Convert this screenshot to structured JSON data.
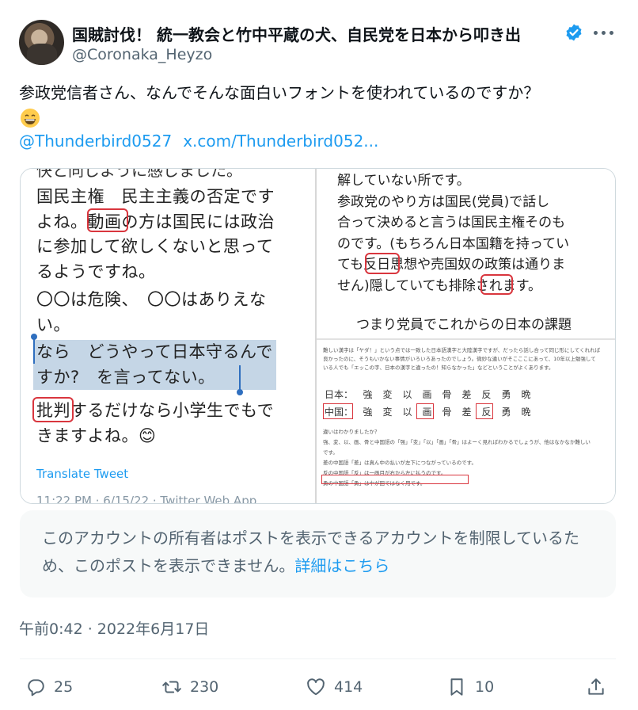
{
  "author": {
    "display_name": "国賊討伐！ 統一教会と竹中平蔵の犬、自民党を日本から叩き出",
    "handle": "@Coronaka_Heyzo",
    "verified_color": "#1d9bf0"
  },
  "tweet": {
    "text": "参政党信者さん、なんでそんな面白いフォントを使われているのですか？",
    "emoji": "grinning-face",
    "mention": "@Thunderbird0527",
    "link": "x.com/Thunderbird052..."
  },
  "media": {
    "left": {
      "cut_line": "快と同じように感じました。",
      "lines_p1": [
        "国民主権　民主主義の否定です",
        "よね。動画の方は国民には政治",
        "に参加して欲しくないと思って",
        "るようですね。"
      ],
      "lines_p2": [
        "〇〇は危険、　〇〇はありえな",
        "い。"
      ],
      "lines_p3": [
        "なら　どうやって日本守るんで",
        "すか?　を言ってない。"
      ],
      "lines_p4": [
        "批判するだけなら小学生でもで",
        "きますよね。😊"
      ],
      "translate_label": "Translate Tweet",
      "meta_cut": "11:22 PM · 6/15/22 · Twitter Web App"
    },
    "right": {
      "lines_top": [
        "解していない所です。",
        "参政党のやり方は国民(党員)で話し",
        "合って決めると言うは国民主権そのも",
        "のです。(もちろん日本国籍を持ってい",
        "ても反日思想や売国奴の政策は通りま",
        "せん)隠していても排除されます。"
      ],
      "heading": "つまり党員でこれからの日本の課題",
      "small_top": [
        "難しい漢字は「ヤダ！」という点では一致した日本語漢字と大陸漢字ですが、だったら話し合って同じ形にしてくれれば",
        "良かったのに、そうもいかない事情がいろいろあったのでしょう。微妙な違いがそこここにあって、10年以上勉強して",
        "いる人でも「エッこの字、日本の漢字と違ったの！知らなかった」などということがよくあります。"
      ],
      "row_japan_label": "日本：",
      "row_china_label": "中国：",
      "kanji": [
        "強",
        "変",
        "以",
        "画",
        "骨",
        "差",
        "反",
        "勇",
        "晩"
      ],
      "small_bottom": [
        "違いはわかりましたか？",
        "強、変、以、画、骨と中国語の「强」「变」「以」「画」「骨」はよーく見ればわかるでしょうが、他はなかなか難しい",
        "です。",
        "差の中国語「差」は真ん中の払いが左下につながっているのです。",
        "反の中国語「反」は一画目が右から左に払うのです。",
        "勇の中国語「勇」は中が田ではなく用です。"
      ]
    }
  },
  "notice": {
    "text": "このアカウントの所有者はポストを表示できるアカウントを制限しているため、このポストを表示できません。",
    "link": "詳細はこちら"
  },
  "timestamp": "午前0:42 · 2022年6月17日",
  "actions": {
    "replies": "25",
    "retweets": "230",
    "likes": "414",
    "bookmarks": "10"
  }
}
